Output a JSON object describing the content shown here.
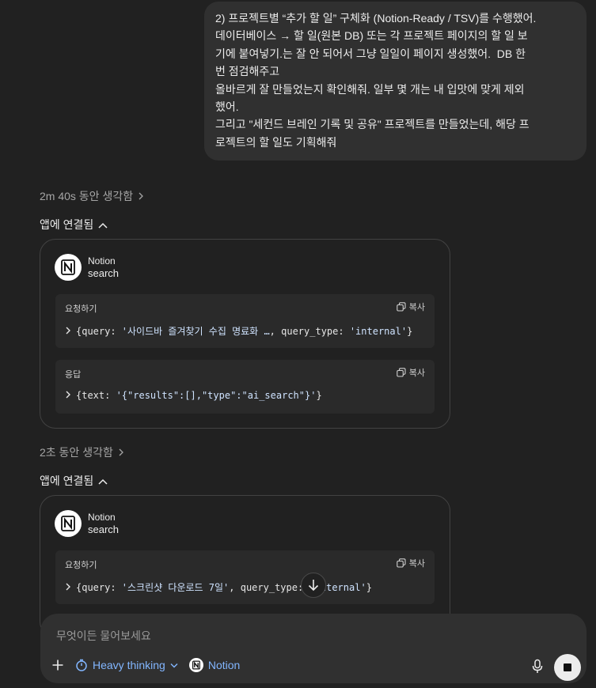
{
  "user_message": {
    "lines": [
      "2) 프로젝트별 “추가 할 일” 구체화 (Notion-Ready / TSV)를 수행했어.",
      "데이터베이스 → 할 일(원본 DB) 또는 각 프로젝트 페이지의 할 일 보",
      "기에 붙여넣기.는 잘 안 되어서 그냥 일일이 페이지 생성했어.  DB 한",
      "번 점검해주고",
      "올바르게 잘 만들었는지 확인해줘. 일부 몇 개는 내 입맛에 맞게 제외",
      "했어.",
      "그리고 \"세컨드 브레인 기록 및 공유\" 프로젝트를 만들었는데, 해당 프",
      "로젝트의 할 일도 기획해줘"
    ]
  },
  "blocks": [
    {
      "thinking": "2m 40s 동안 생각함",
      "connected": "앱에 연결됨",
      "app": "Notion",
      "tool": "search",
      "request_label": "요청하기",
      "request_code_pre": "{query: ",
      "request_code_str": "'사이드바 즐겨찾기 수집 명료화 …",
      "request_code_post": ", query_type: ",
      "request_code_str2": "'internal'",
      "request_code_end": "}",
      "response_label": "응답",
      "response_code_pre": "{text: ",
      "response_code_str": "'{\"results\":[],\"type\":\"ai_search\"}'",
      "response_code_end": "}",
      "copy_label": "복사"
    },
    {
      "thinking": "2초 동안 생각함",
      "connected": "앱에 연결됨",
      "app": "Notion",
      "tool": "search",
      "request_label": "요청하기",
      "request_code_pre": "{query: ",
      "request_code_str": "'스크린샷 다운로드 7일'",
      "request_code_post": ", query_type: ",
      "request_code_str2": "'internal'",
      "request_code_end": "}",
      "copy_label": "복사"
    }
  ],
  "composer": {
    "placeholder": "무엇이든 물어보세요",
    "mode_label": "Heavy thinking",
    "connector_label": "Notion"
  },
  "colors": {
    "background": "#212121",
    "bubble": "#303030",
    "accent": "#82b6ff"
  }
}
